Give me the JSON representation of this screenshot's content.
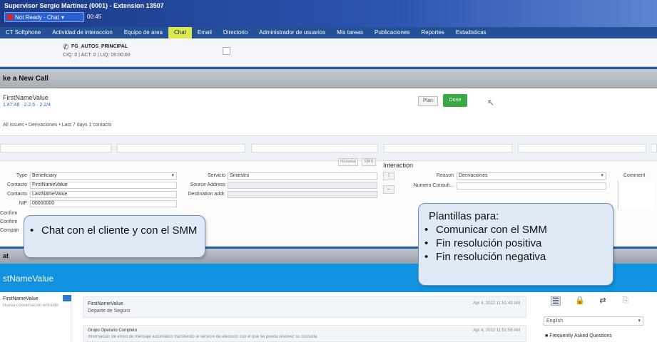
{
  "window": {
    "title": "Supervisor Sergio Martinez (0001) - Extension 13507",
    "status": "Not Ready - Chat",
    "timer": "00:45"
  },
  "menu": {
    "items": [
      {
        "label": "CT Softphone",
        "active": false
      },
      {
        "label": "Actividad de interaccion",
        "active": false
      },
      {
        "label": "Equipo de area",
        "active": false
      },
      {
        "label": "Chat",
        "active": true
      },
      {
        "label": "Email",
        "active": false
      },
      {
        "label": "Directorio",
        "active": false
      },
      {
        "label": "Administrador de usuarios",
        "active": false
      },
      {
        "label": "Mis tareas",
        "active": false
      },
      {
        "label": "Publicaciones",
        "active": false
      },
      {
        "label": "Reportes",
        "active": false
      },
      {
        "label": "Estadisticas",
        "active": false
      }
    ]
  },
  "agent": {
    "queue": "FG_AUTOS_PRINCIPAL",
    "stats": "CIQ: 0 | ACT: 0 | LIQ: 00:00:00"
  },
  "make_call": {
    "title": "ke a New Call"
  },
  "contact": {
    "name": "FirstNameValue",
    "sub": "1:47:48 · 2.2.5 · 2.2/4",
    "filters_text": "All issues  • Derivaciones  • Last 7 days  1 contacts",
    "plan_label": "Plan",
    "done_label": "Done"
  },
  "form": {
    "small_buttons": [
      "Historial",
      "SMS"
    ],
    "interaction_title": "Interaction",
    "left_fields": [
      {
        "label": "Type",
        "value": "Beneficiary",
        "select": true
      },
      {
        "label": "Contacto",
        "value": "FirstNameValue",
        "select": false
      },
      {
        "label": "Contacto",
        "value": "LastNameValue",
        "select": false
      },
      {
        "label": "NIF",
        "value": "00000000",
        "select": false
      }
    ],
    "left_extra_labels": [
      "Confirm",
      "Confirm",
      "Compan"
    ],
    "mid_fields": [
      {
        "label": "Servicio",
        "value": "Siniestro"
      },
      {
        "label": "Source Address",
        "value": ""
      },
      {
        "label": "Destination addr.",
        "value": ""
      }
    ],
    "reason_label": "Reason",
    "reason_value": "Derivaciones",
    "number_label": "Numero Consult...",
    "comment_label": "Comment"
  },
  "callouts": {
    "left": [
      "Chat con el cliente y con el SMM"
    ],
    "right_title": "Plantillas para:",
    "right_items": [
      "Comunicar con el SMM",
      "Fin resolución positiva",
      "Fin resolución negativa"
    ]
  },
  "chat": {
    "section_label": "at",
    "header_name": "stNameValue",
    "side_name": "FirstNameValue",
    "side_sub": "Nueva conversación entrante",
    "messages": [
      {
        "name": "FirstNameValue",
        "text": "Departe de Seguro",
        "time": "Apr 4, 2022 11:51:43 AM"
      },
      {
        "name": "Grupo Operario Completo",
        "text": "Información de envío de mensaje automático transferido al servicio de atención con el que se pueda resolver su consulta",
        "time": "Apr 4, 2022 11:51:56 AM"
      }
    ],
    "lang_value": "English",
    "faq_label": "Frequently Asked Questions"
  }
}
